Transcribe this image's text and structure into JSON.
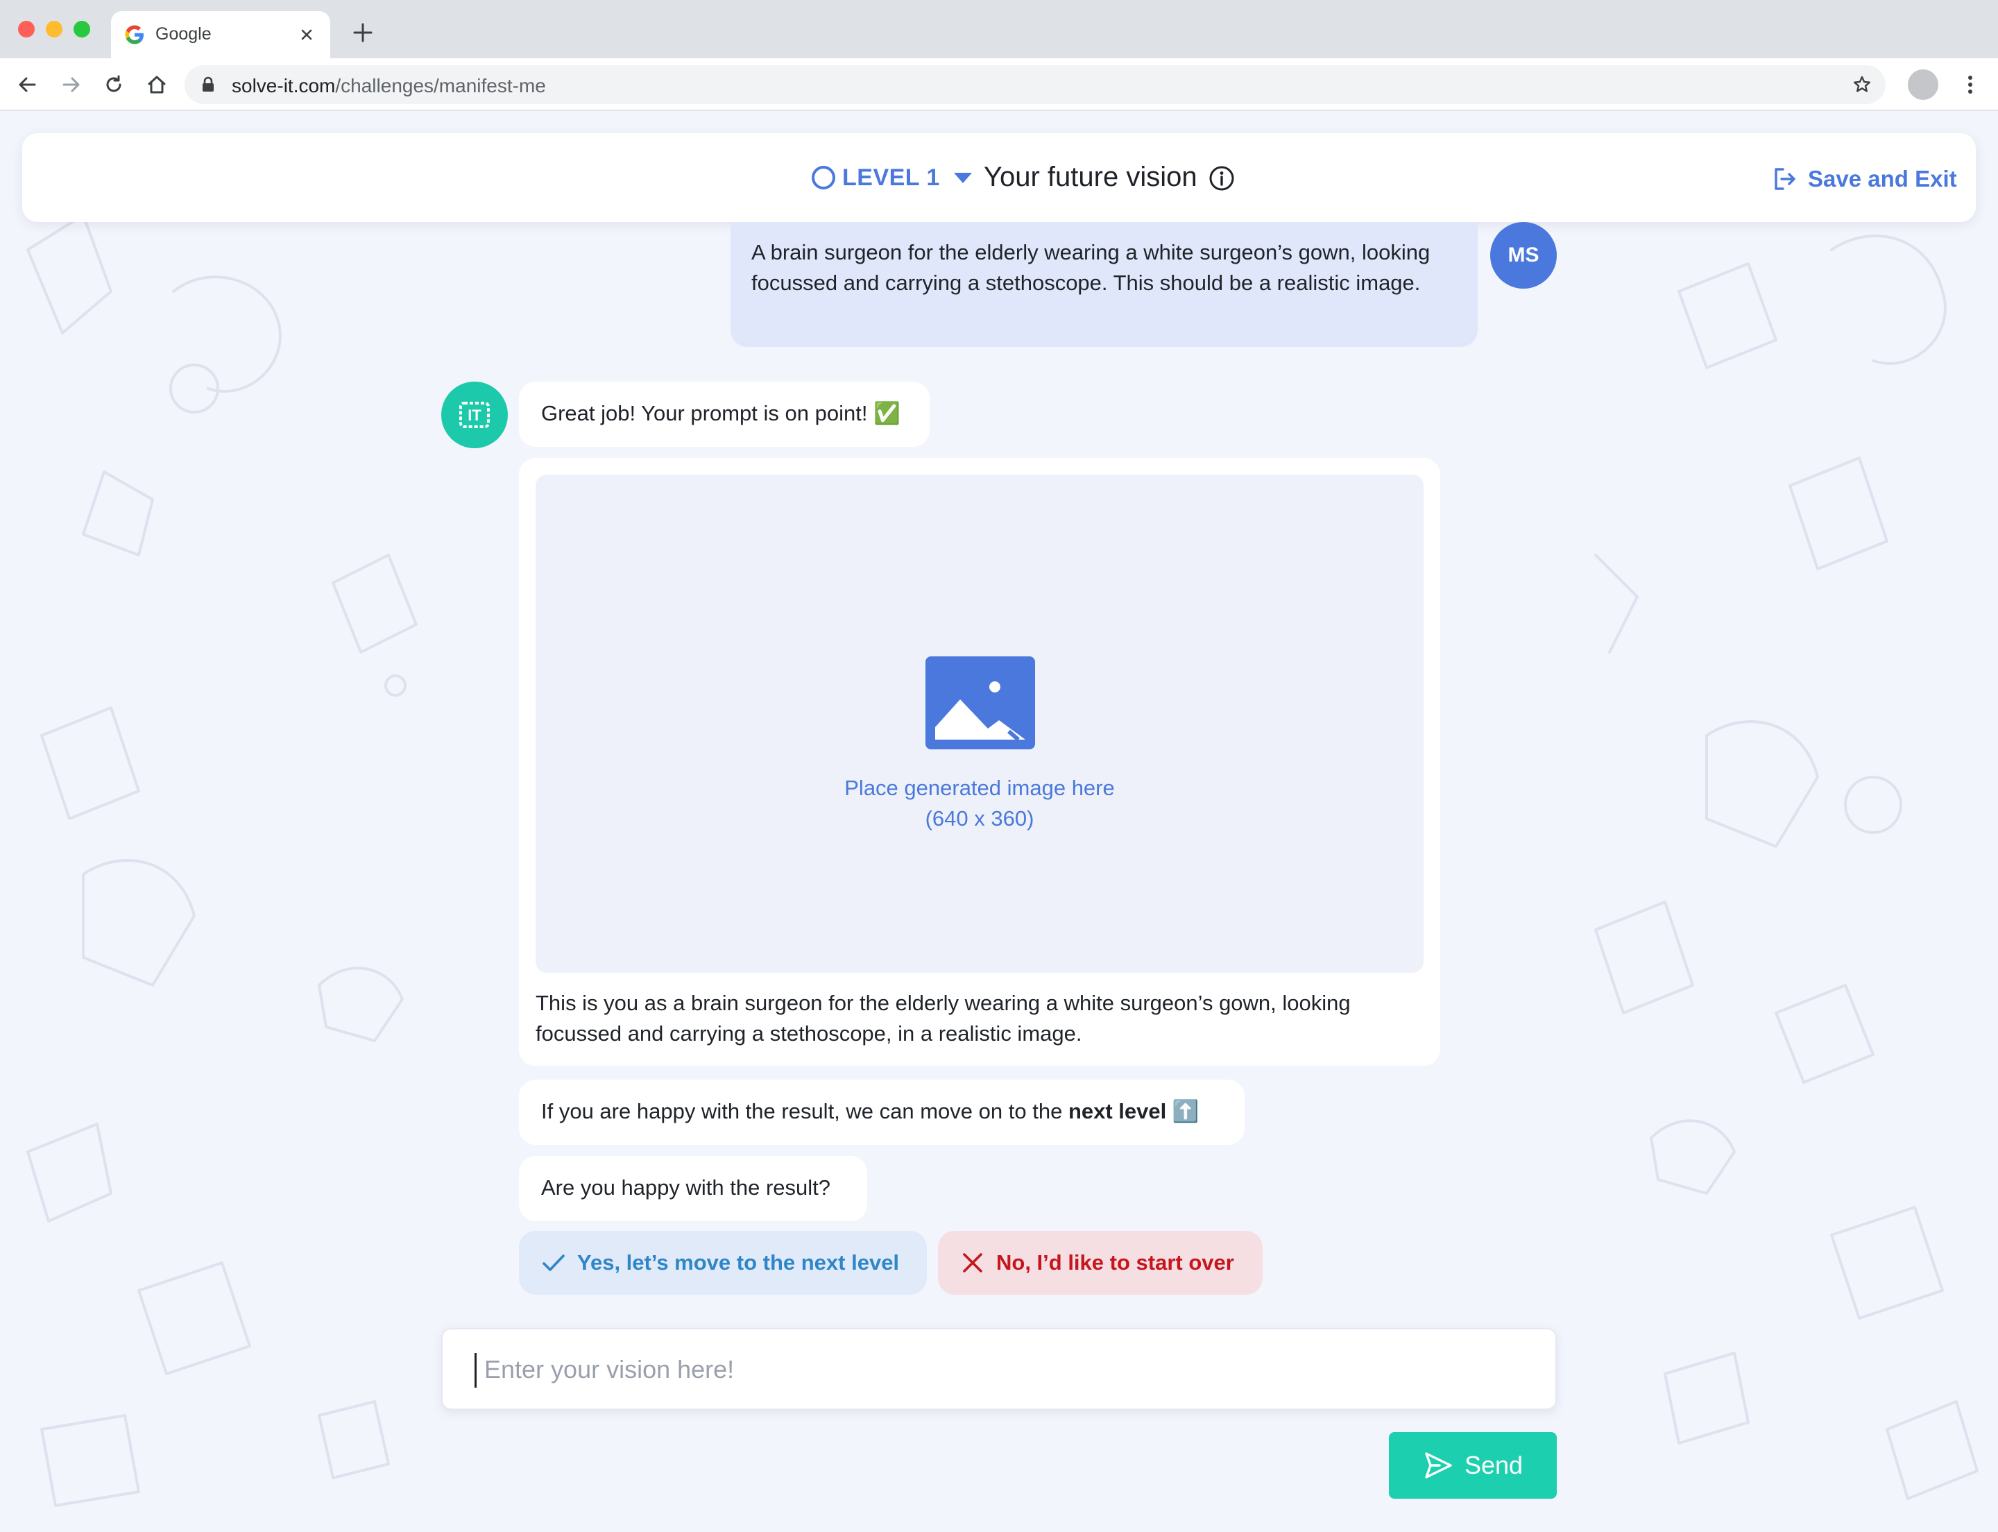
{
  "browser": {
    "tab_title": "Google",
    "url_domain": "solve-it.com",
    "url_path": "/challenges/manifest-me"
  },
  "header": {
    "level_label": "LEVEL 1",
    "challenge_title": "Your future vision",
    "save_exit_label": "Save and Exit"
  },
  "chat": {
    "user_initials": "MS",
    "user_message": "A brain surgeon for the elderly wearing a white surgeon’s gown, looking focussed and carrying a stethoscope. This should be a realistic image.",
    "bot_avatar_text": "IT",
    "bot_praise": "Great job! Your prompt is on point! ✅",
    "image_placeholder_line1": "Place generated image here",
    "image_placeholder_line2": "(640 x 360)",
    "image_caption": "This is you as a brain surgeon for the elderly wearing a white surgeon’s gown, looking focussed and carrying a stethoscope, in a realistic image.",
    "next_level_prefix": "If you are happy with the result, we can move on to the ",
    "next_level_bold": "next level",
    "next_level_emoji": "⬆️",
    "question": "Are you happy with the result?",
    "yes_label": "Yes, let’s move to the next level",
    "no_label": "No, I’d like to start over"
  },
  "composer": {
    "placeholder": "Enter your vision here!",
    "send_label": "Send"
  },
  "colors": {
    "primary_blue": "#4a78dc",
    "teal": "#1ccfae",
    "user_bubble": "#e1e7fb",
    "danger_red": "#c5161d"
  }
}
